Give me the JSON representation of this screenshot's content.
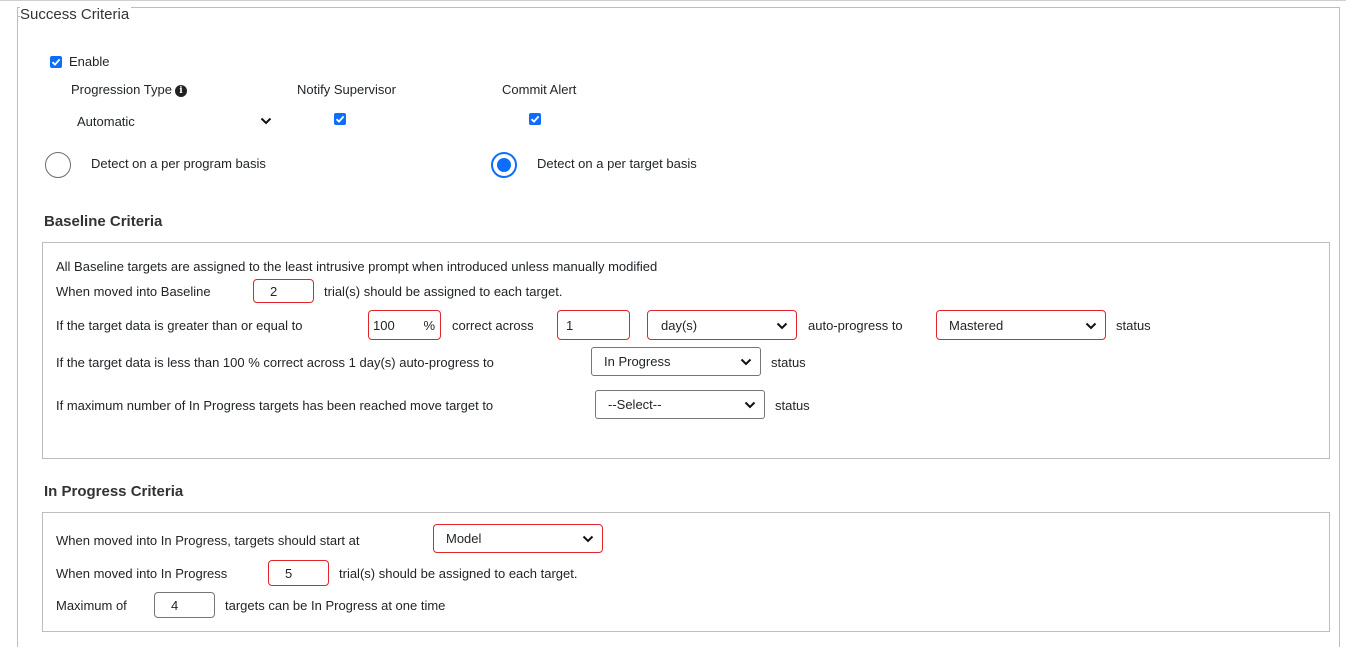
{
  "success_criteria": {
    "legend": "Success Criteria",
    "enable_label": "Enable",
    "enable_checked": true,
    "progression_type_label": "Progression Type",
    "progression_type_value": "Automatic",
    "notify_supervisor_label": "Notify Supervisor",
    "notify_supervisor_checked": true,
    "commit_alert_label": "Commit Alert",
    "commit_alert_checked": true,
    "radio_program_label": "Detect on a per program basis",
    "radio_target_label": "Detect on a per target basis",
    "selected_radio": "target"
  },
  "baseline": {
    "heading": "Baseline Criteria",
    "intro": "All Baseline targets are assigned to the least intrusive prompt when introduced unless manually modified",
    "moved_prefix": "When moved into Baseline",
    "trials_value": "2",
    "moved_suffix": "trial(s) should be assigned to each target.",
    "gte_prefix": "If the target data is greater than or equal to",
    "percent_value": "100",
    "percent_sign": "%",
    "correct_across": "correct across",
    "days_value": "1",
    "period_value": "day(s)",
    "auto_progress_to": "auto-progress to",
    "gte_status_value": "Mastered",
    "status_word": "status",
    "lt_sentence": "If the target data is less than 100 % correct across 1 day(s) auto-progress to",
    "lt_status_value": "In Progress",
    "max_sentence": "If maximum number of In Progress targets has been reached move target to",
    "max_status_value": "--Select--"
  },
  "in_progress": {
    "heading": "In Progress Criteria",
    "start_prefix": "When moved into In Progress, targets should start at",
    "start_value": "Model",
    "moved_prefix": "When moved into In Progress",
    "trials_value": "5",
    "moved_suffix": "trial(s) should be assigned to each target.",
    "max_prefix": "Maximum of",
    "max_value": "4",
    "max_suffix": "targets can be In Progress at one time"
  },
  "colors": {
    "accent": "#0d6efd",
    "validation_border": "#e0262b"
  }
}
